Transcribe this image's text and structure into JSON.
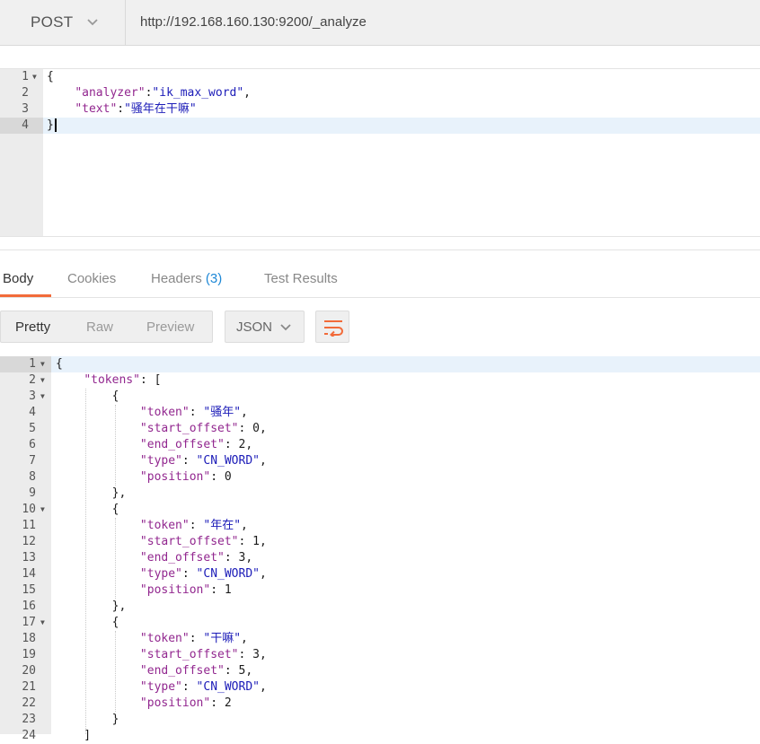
{
  "request": {
    "method": "POST",
    "url": "http://192.168.160.130:9200/_analyze"
  },
  "request_body": {
    "lines": [
      {
        "num": "1",
        "fold": true,
        "parts": [
          {
            "t": "{",
            "c": "n"
          }
        ]
      },
      {
        "num": "2",
        "fold": false,
        "parts": [
          {
            "t": "    ",
            "c": "n"
          },
          {
            "t": "\"analyzer\"",
            "c": "k"
          },
          {
            "t": ":",
            "c": "n"
          },
          {
            "t": "\"ik_max_word\"",
            "c": "s"
          },
          {
            "t": ",",
            "c": "n"
          }
        ]
      },
      {
        "num": "3",
        "fold": false,
        "parts": [
          {
            "t": "    ",
            "c": "n"
          },
          {
            "t": "\"text\"",
            "c": "k"
          },
          {
            "t": ":",
            "c": "n"
          },
          {
            "t": "\"骚年在干嘛\"",
            "c": "s"
          }
        ]
      },
      {
        "num": "4",
        "fold": false,
        "parts": [
          {
            "t": "}",
            "c": "n"
          }
        ],
        "active": true,
        "cursor": true
      }
    ]
  },
  "response_tabs": {
    "body": "Body",
    "cookies": "Cookies",
    "headers": "Headers",
    "headers_count": "(3)",
    "test_results": "Test Results"
  },
  "toolbar": {
    "pretty": "Pretty",
    "raw": "Raw",
    "preview": "Preview",
    "format": "JSON"
  },
  "response_body": {
    "lines": [
      {
        "num": "1",
        "fold": true,
        "active": true,
        "parts": [
          {
            "t": "{",
            "c": "n"
          }
        ]
      },
      {
        "num": "2",
        "fold": true,
        "parts": [
          {
            "t": "    ",
            "c": "n"
          },
          {
            "t": "\"tokens\"",
            "c": "k"
          },
          {
            "t": ": [",
            "c": "n"
          }
        ]
      },
      {
        "num": "3",
        "fold": true,
        "parts": [
          {
            "t": "        {",
            "c": "n"
          }
        ]
      },
      {
        "num": "4",
        "fold": false,
        "parts": [
          {
            "t": "            ",
            "c": "n"
          },
          {
            "t": "\"token\"",
            "c": "k"
          },
          {
            "t": ": ",
            "c": "n"
          },
          {
            "t": "\"骚年\"",
            "c": "s"
          },
          {
            "t": ",",
            "c": "n"
          }
        ]
      },
      {
        "num": "5",
        "fold": false,
        "parts": [
          {
            "t": "            ",
            "c": "n"
          },
          {
            "t": "\"start_offset\"",
            "c": "k"
          },
          {
            "t": ": 0,",
            "c": "n"
          }
        ]
      },
      {
        "num": "6",
        "fold": false,
        "parts": [
          {
            "t": "            ",
            "c": "n"
          },
          {
            "t": "\"end_offset\"",
            "c": "k"
          },
          {
            "t": ": 2,",
            "c": "n"
          }
        ]
      },
      {
        "num": "7",
        "fold": false,
        "parts": [
          {
            "t": "            ",
            "c": "n"
          },
          {
            "t": "\"type\"",
            "c": "k"
          },
          {
            "t": ": ",
            "c": "n"
          },
          {
            "t": "\"CN_WORD\"",
            "c": "s"
          },
          {
            "t": ",",
            "c": "n"
          }
        ]
      },
      {
        "num": "8",
        "fold": false,
        "parts": [
          {
            "t": "            ",
            "c": "n"
          },
          {
            "t": "\"position\"",
            "c": "k"
          },
          {
            "t": ": 0",
            "c": "n"
          }
        ]
      },
      {
        "num": "9",
        "fold": false,
        "parts": [
          {
            "t": "        },",
            "c": "n"
          }
        ]
      },
      {
        "num": "10",
        "fold": true,
        "parts": [
          {
            "t": "        {",
            "c": "n"
          }
        ]
      },
      {
        "num": "11",
        "fold": false,
        "parts": [
          {
            "t": "            ",
            "c": "n"
          },
          {
            "t": "\"token\"",
            "c": "k"
          },
          {
            "t": ": ",
            "c": "n"
          },
          {
            "t": "\"年在\"",
            "c": "s"
          },
          {
            "t": ",",
            "c": "n"
          }
        ]
      },
      {
        "num": "12",
        "fold": false,
        "parts": [
          {
            "t": "            ",
            "c": "n"
          },
          {
            "t": "\"start_offset\"",
            "c": "k"
          },
          {
            "t": ": 1,",
            "c": "n"
          }
        ]
      },
      {
        "num": "13",
        "fold": false,
        "parts": [
          {
            "t": "            ",
            "c": "n"
          },
          {
            "t": "\"end_offset\"",
            "c": "k"
          },
          {
            "t": ": 3,",
            "c": "n"
          }
        ]
      },
      {
        "num": "14",
        "fold": false,
        "parts": [
          {
            "t": "            ",
            "c": "n"
          },
          {
            "t": "\"type\"",
            "c": "k"
          },
          {
            "t": ": ",
            "c": "n"
          },
          {
            "t": "\"CN_WORD\"",
            "c": "s"
          },
          {
            "t": ",",
            "c": "n"
          }
        ]
      },
      {
        "num": "15",
        "fold": false,
        "parts": [
          {
            "t": "            ",
            "c": "n"
          },
          {
            "t": "\"position\"",
            "c": "k"
          },
          {
            "t": ": 1",
            "c": "n"
          }
        ]
      },
      {
        "num": "16",
        "fold": false,
        "parts": [
          {
            "t": "        },",
            "c": "n"
          }
        ]
      },
      {
        "num": "17",
        "fold": true,
        "parts": [
          {
            "t": "        {",
            "c": "n"
          }
        ]
      },
      {
        "num": "18",
        "fold": false,
        "parts": [
          {
            "t": "            ",
            "c": "n"
          },
          {
            "t": "\"token\"",
            "c": "k"
          },
          {
            "t": ": ",
            "c": "n"
          },
          {
            "t": "\"干嘛\"",
            "c": "s"
          },
          {
            "t": ",",
            "c": "n"
          }
        ]
      },
      {
        "num": "19",
        "fold": false,
        "parts": [
          {
            "t": "            ",
            "c": "n"
          },
          {
            "t": "\"start_offset\"",
            "c": "k"
          },
          {
            "t": ": 3,",
            "c": "n"
          }
        ]
      },
      {
        "num": "20",
        "fold": false,
        "parts": [
          {
            "t": "            ",
            "c": "n"
          },
          {
            "t": "\"end_offset\"",
            "c": "k"
          },
          {
            "t": ": 5,",
            "c": "n"
          }
        ]
      },
      {
        "num": "21",
        "fold": false,
        "parts": [
          {
            "t": "            ",
            "c": "n"
          },
          {
            "t": "\"type\"",
            "c": "k"
          },
          {
            "t": ": ",
            "c": "n"
          },
          {
            "t": "\"CN_WORD\"",
            "c": "s"
          },
          {
            "t": ",",
            "c": "n"
          }
        ]
      },
      {
        "num": "22",
        "fold": false,
        "parts": [
          {
            "t": "            ",
            "c": "n"
          },
          {
            "t": "\"position\"",
            "c": "k"
          },
          {
            "t": ": 2",
            "c": "n"
          }
        ]
      },
      {
        "num": "23",
        "fold": false,
        "parts": [
          {
            "t": "        }",
            "c": "n"
          }
        ]
      },
      {
        "num": "24",
        "fold": false,
        "parts": [
          {
            "t": "    ]",
            "c": "n"
          }
        ]
      }
    ]
  },
  "icons": {
    "method_dropdown": "chevron-down-icon",
    "format_dropdown": "chevron-down-icon",
    "wrap": "wrap-lines-icon"
  },
  "colors": {
    "accent": "#f26b3a",
    "badge": "#1e88d6",
    "json_key": "#92278f",
    "json_string": "#1c1cb8"
  }
}
